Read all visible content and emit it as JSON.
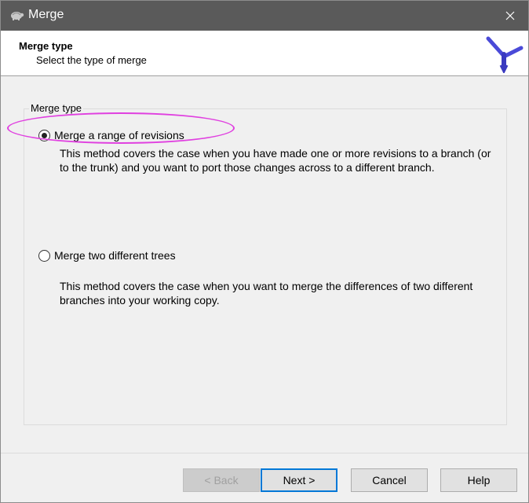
{
  "window": {
    "title": "Merge",
    "app_icon": "tortoise-icon",
    "close_icon": "close-icon",
    "titlebar_color": "#5a5a5a"
  },
  "header": {
    "title": "Merge type",
    "subtitle": "Select the type of merge",
    "logo_icon": "merge-logo-icon"
  },
  "group": {
    "legend": "Merge type",
    "options": [
      {
        "label": "Merge a range of revisions",
        "checked": true,
        "description": "This method covers the case when you have made one or more revisions to a branch (or to the trunk) and you want to port those changes across to a different branch."
      },
      {
        "label": "Merge two different trees",
        "checked": false,
        "description": "This method covers the case when you want to merge the differences of two different branches into your working copy."
      }
    ]
  },
  "buttons": {
    "back": "< Back",
    "next": "Next >",
    "cancel": "Cancel",
    "help": "Help"
  },
  "annotation_color": "#e040e0"
}
